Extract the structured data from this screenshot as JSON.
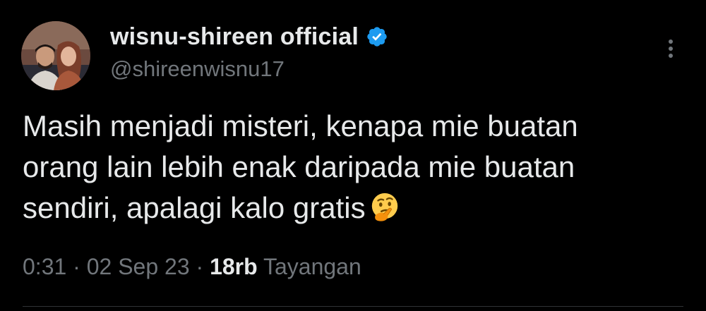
{
  "author": {
    "display_name": "wisnu-shireen official",
    "handle": "@shireenwisnu17",
    "verified": true,
    "verified_color": "#1d9bf0",
    "avatar_icon": "profile-photo"
  },
  "tweet": {
    "text": "Masih menjadi misteri, kenapa mie buatan\norang lain lebih enak daripada mie buatan\nsendiri, apalagi kalo gratis",
    "emoji": "thinking-face-emoji"
  },
  "meta": {
    "time": "0:31",
    "separator": "·",
    "date": "02 Sep 23",
    "views_count": "18rb",
    "views_label": "Tayangan"
  },
  "menu": {
    "icon": "more-vertical-icon"
  },
  "colors": {
    "background": "#000000",
    "text_primary": "#e7e9ea",
    "text_secondary": "#71767b",
    "accent": "#1d9bf0"
  }
}
